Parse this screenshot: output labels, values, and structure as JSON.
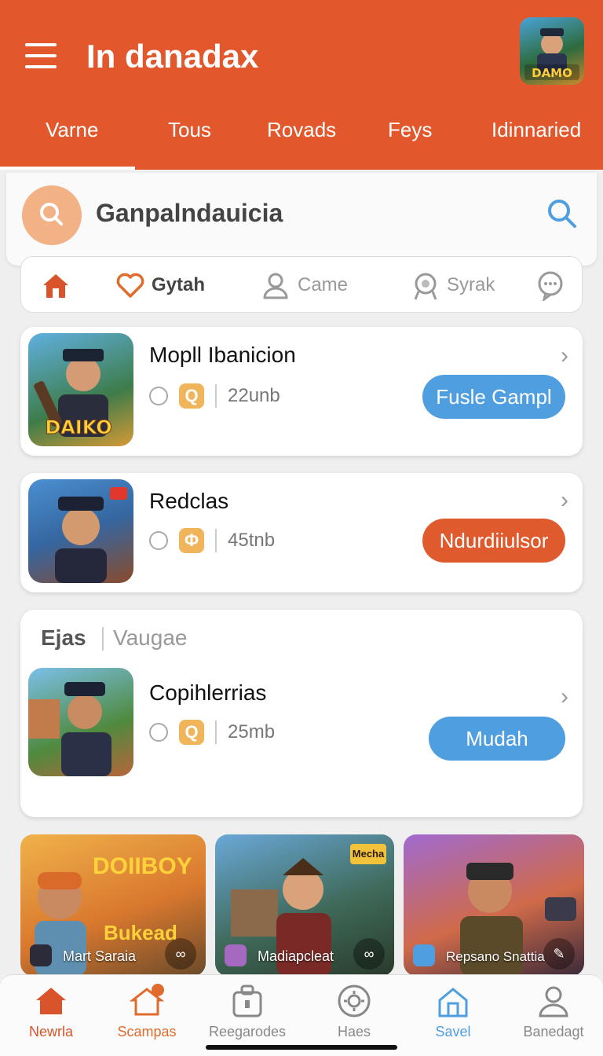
{
  "header": {
    "title": "In danadax",
    "tabs": [
      {
        "label": "Varne",
        "active": true
      },
      {
        "label": "Tous"
      },
      {
        "label": "Rovads"
      },
      {
        "label": "Feys"
      },
      {
        "label": "Idinnaried"
      }
    ],
    "avatar_logo": "DAMO",
    "accent_color": "#e2582c"
  },
  "search": {
    "placeholder": "Ganpalndauicia",
    "icon": "search-icon"
  },
  "categories": [
    {
      "label": "",
      "icon": "home-icon",
      "active": true
    },
    {
      "label": "Gytah",
      "icon": "heart-icon"
    },
    {
      "label": "Came",
      "icon": "user-icon"
    },
    {
      "label": "Syrak",
      "icon": "badge-icon"
    },
    {
      "label": "",
      "icon": "chat-icon"
    }
  ],
  "apps": [
    {
      "name": "Mopll Ibanicion",
      "size": "22unb",
      "badge": "Q",
      "button": "Fusle Gampl",
      "button_color": "#4f9ee0",
      "logo": "DAIKO"
    },
    {
      "name": "Redclas",
      "size": "45tnb",
      "badge": "Φ",
      "button": "Ndurdiiulsor",
      "button_color": "#df5a2c",
      "logo": ""
    }
  ],
  "section": {
    "title": "Ejas",
    "subtitle": "Vaugae",
    "app": {
      "name": "Copihlerrias",
      "size": "25mb",
      "badge": "Q",
      "button": "Mudah",
      "button_color": "#4f9ee0"
    }
  },
  "promos": [
    {
      "label": "Mart Saraia",
      "logo_line1": "DOIIBOY",
      "logo_line2": "Bukead",
      "link_icon": "link-icon"
    },
    {
      "label": "Madiapcleat",
      "logo_line1": "Mecha",
      "logo_line2": "",
      "link_icon": "link-icon"
    },
    {
      "label": "Repsano Snattia",
      "logo_line1": "",
      "logo_line2": "",
      "link_icon": "edit-icon"
    }
  ],
  "bottom_nav": [
    {
      "label": "Newrla",
      "icon": "home-icon",
      "color": "#d9542a"
    },
    {
      "label": "Scampas",
      "icon": "house-outline-icon",
      "color": "#e06b2c"
    },
    {
      "label": "Reegarodes",
      "icon": "bag-icon",
      "color": "#888888"
    },
    {
      "label": "Haes",
      "icon": "gear-icon",
      "color": "#888888"
    },
    {
      "label": "Savel",
      "icon": "save-icon",
      "color": "#4f9ee0"
    },
    {
      "label": "Banedagt",
      "icon": "profile-icon",
      "color": "#888888"
    }
  ]
}
